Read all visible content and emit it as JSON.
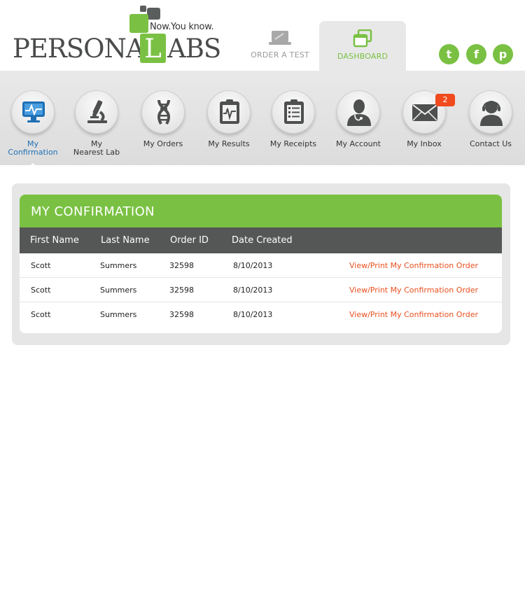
{
  "header": {
    "logo": {
      "tagline": "Now.You know.",
      "brand_left": "PERSONA",
      "brand_l": "L",
      "brand_right": "ABS"
    },
    "tabs": [
      {
        "label": "ORDER A TEST",
        "icon": "laptop-icon"
      },
      {
        "label": "DASHBOARD",
        "icon": "dashboard-windows-icon"
      }
    ],
    "social": [
      {
        "name": "twitter-icon",
        "glyph": "t"
      },
      {
        "name": "facebook-icon",
        "glyph": "f"
      },
      {
        "name": "pinterest-icon",
        "glyph": "p"
      }
    ],
    "colors": {
      "accent_green": "#7ac143",
      "dark_grey": "#545755",
      "link_orange": "#e8501f",
      "active_blue": "#1f6fb5"
    }
  },
  "nav": {
    "items": [
      {
        "line1": "My",
        "line2": "Confirmation",
        "icon": "monitor-icon"
      },
      {
        "line1": "My",
        "line2": "Nearest Lab",
        "icon": "microscope-icon"
      },
      {
        "line1": "My Orders",
        "line2": "",
        "icon": "dna-icon"
      },
      {
        "line1": "My Results",
        "line2": "",
        "icon": "clipboard-chart-icon"
      },
      {
        "line1": "My Receipts",
        "line2": "",
        "icon": "receipt-list-icon"
      },
      {
        "line1": "My Account",
        "line2": "",
        "icon": "doctor-icon"
      },
      {
        "line1": "My Inbox",
        "line2": "",
        "icon": "envelope-icon",
        "badge": "2"
      },
      {
        "line1": "Contact Us",
        "line2": "",
        "icon": "headset-icon"
      }
    ]
  },
  "main": {
    "title": "MY CONFIRMATION",
    "columns": [
      "First Name",
      "Last Name",
      "Order ID",
      "Date Created"
    ],
    "rows": [
      {
        "first": "Scott",
        "last": "Summers",
        "order_id": "32598",
        "date": "8/10/2013",
        "action": "View/Print My Confirmation Order"
      },
      {
        "first": "Scott",
        "last": "Summers",
        "order_id": "32598",
        "date": "8/10/2013",
        "action": "View/Print My Confirmation Order"
      },
      {
        "first": "Scott",
        "last": "Summers",
        "order_id": "32598",
        "date": "8/10/2013",
        "action": "View/Print My Confirmation Order"
      }
    ]
  }
}
